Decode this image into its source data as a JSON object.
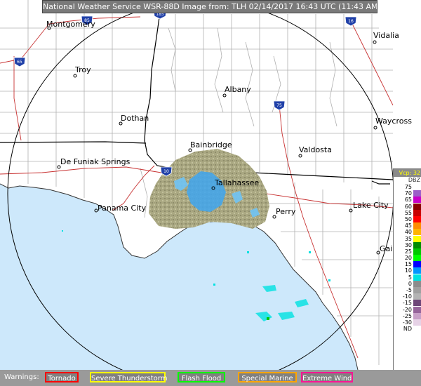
{
  "header": {
    "title": "National Weather Service WSR-88D Image from: TLH 02/14/2017 16:43 UTC (11:43 AM EST)"
  },
  "cities": [
    {
      "name": "Montgomery"
    },
    {
      "name": "Troy"
    },
    {
      "name": "Dothan"
    },
    {
      "name": "Albany"
    },
    {
      "name": "Vidalia"
    },
    {
      "name": "Waycross"
    },
    {
      "name": "Bainbridge"
    },
    {
      "name": "Valdosta"
    },
    {
      "name": "De Funiak Springs"
    },
    {
      "name": "Tallahassee"
    },
    {
      "name": "Panama City"
    },
    {
      "name": "Perry"
    },
    {
      "name": "Lake City"
    },
    {
      "name": "Gai"
    }
  ],
  "interstates": [
    {
      "number": "85"
    },
    {
      "name": "65"
    },
    {
      "number": "185"
    },
    {
      "number": "16"
    },
    {
      "number": "75"
    },
    {
      "number": "10"
    }
  ],
  "legend": {
    "mode": "Vcp: 32",
    "unit": "DBZ",
    "levels": [
      {
        "value": "75",
        "color": "#ffffff"
      },
      {
        "value": "70",
        "color": "#9b5fc8"
      },
      {
        "value": "65",
        "color": "#c800c8"
      },
      {
        "value": "60",
        "color": "#8b0000"
      },
      {
        "value": "55",
        "color": "#c80000"
      },
      {
        "value": "50",
        "color": "#ff0000"
      },
      {
        "value": "45",
        "color": "#ff8c00"
      },
      {
        "value": "40",
        "color": "#ffb400"
      },
      {
        "value": "35",
        "color": "#ffff00"
      },
      {
        "value": "30",
        "color": "#008c00"
      },
      {
        "value": "25",
        "color": "#00c800"
      },
      {
        "value": "20",
        "color": "#00ff00"
      },
      {
        "value": "15",
        "color": "#0000ff"
      },
      {
        "value": "10",
        "color": "#0096ff"
      },
      {
        "value": "5",
        "color": "#00e1e1"
      },
      {
        "value": "0",
        "color": "#8c8c8c"
      },
      {
        "value": "-5",
        "color": "#a0a0a0"
      },
      {
        "value": "-10",
        "color": "#b4b4b4"
      },
      {
        "value": "-15",
        "color": "#6e4678"
      },
      {
        "value": "-20",
        "color": "#96649b"
      },
      {
        "value": "-25",
        "color": "#c8a0c8"
      },
      {
        "value": "-30",
        "color": "#e6d2e6"
      },
      {
        "value": "ND",
        "color": "#ffffff"
      }
    ]
  },
  "warnings": {
    "label": "Warnings:",
    "items": [
      {
        "label": "Tornado",
        "color": "#ff0000"
      },
      {
        "label": "Severe Thunderstorm",
        "color": "#ffff00"
      },
      {
        "label": "Flash Flood",
        "color": "#00ff00"
      },
      {
        "label": "Special Marine",
        "color": "#ffa500"
      },
      {
        "label": "Extreme Wind",
        "color": "#ff1493"
      }
    ]
  },
  "colors": {
    "ocean": "#cde8fb",
    "land": "#ffffff",
    "county_lines": "#b0b0b0",
    "state_lines": "#000000",
    "roads": "#c83232",
    "range_ring": "#000000",
    "echo_light": "#aaa882",
    "echo_blue": "#3fa6f0"
  }
}
